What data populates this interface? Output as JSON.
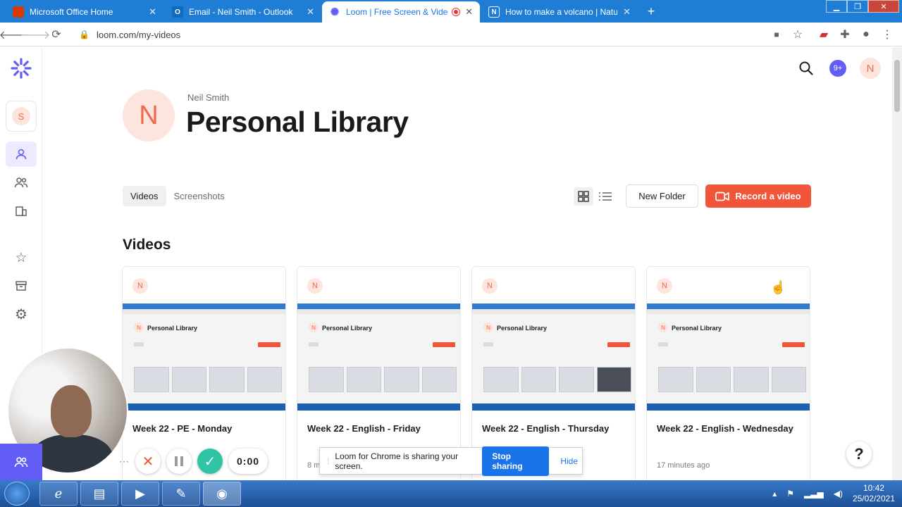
{
  "browser": {
    "tabs": [
      {
        "title": "Microsoft Office Home",
        "fav_letter": "",
        "fav_color": "#d83b01"
      },
      {
        "title": "Email - Neil Smith - Outlook",
        "fav_letter": "O",
        "fav_color": "#0f6cbd"
      },
      {
        "title": "Loom | Free Screen & Video",
        "fav_letter": "",
        "fav_color": "#625df5"
      },
      {
        "title": "How to make a volcano | Natural",
        "fav_letter": "N",
        "fav_color": "#5f6368"
      }
    ],
    "url": "loom.com/my-videos"
  },
  "header": {
    "notifications": "9+",
    "user_initial": "N"
  },
  "sidebar": {
    "workspace_initial": "S"
  },
  "library": {
    "owner": "Neil Smith",
    "owner_initial": "N",
    "title": "Personal Library",
    "tabs": [
      "Videos",
      "Screenshots"
    ],
    "new_folder": "New Folder",
    "record": "Record a video",
    "section_title": "Videos"
  },
  "videos": [
    {
      "title": "Week 22 - PE - Monday",
      "meta": "",
      "initial": "N",
      "thumb_title": "Personal Library"
    },
    {
      "title": "Week 22 - English - Friday",
      "meta": "8 m",
      "initial": "N",
      "thumb_title": "Personal Library"
    },
    {
      "title": "Week 22 - English - Thursday",
      "meta": "",
      "initial": "N",
      "thumb_title": "Personal Library"
    },
    {
      "title": "Week 22 - English - Wednesday",
      "meta": "17 minutes ago",
      "initial": "N",
      "thumb_title": "Personal Library"
    }
  ],
  "recorder": {
    "time": "0:00"
  },
  "share_bar": {
    "message": "Loom for Chrome is sharing your screen.",
    "stop": "Stop sharing",
    "hide": "Hide"
  },
  "help": "?",
  "taskbar": {
    "time": "10:42",
    "date": "25/02/2021"
  },
  "colors": {
    "brand": "#625df5",
    "record": "#f1553a",
    "avatar_bg": "#fde4dc"
  }
}
